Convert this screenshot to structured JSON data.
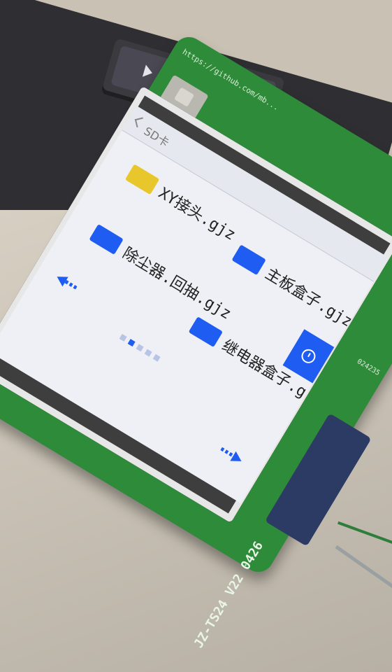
{
  "screen": {
    "title": "SD卡",
    "files": [
      {
        "name": "XY接头.gjz",
        "icon": "yellow-part-icon",
        "color": "#e7c72b"
      },
      {
        "name": "主板盒子.gjz",
        "icon": "blue-part-icon",
        "color": "#1e5cf2"
      },
      {
        "name": "除尘器.回抽.gjz",
        "icon": "blue-part-icon",
        "color": "#1e5cf2"
      },
      {
        "name": "继电器盒子.gjz",
        "icon": "blue-part-icon",
        "color": "#1e5cf2"
      }
    ],
    "pagination": {
      "pages": 5,
      "current": 1
    },
    "accent_color": "#1e5cf2"
  },
  "board": {
    "label": "JZ-TS24 V22 0426",
    "url": "https://github.com/mb...",
    "serial": "024235"
  }
}
